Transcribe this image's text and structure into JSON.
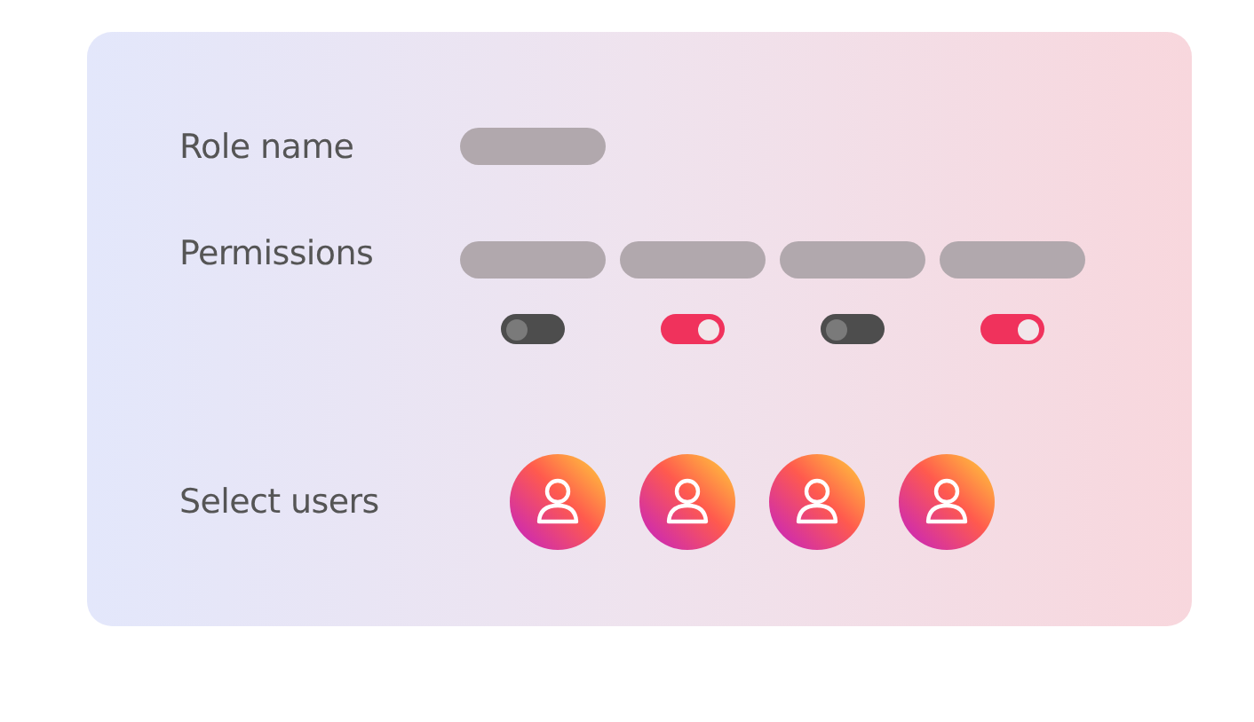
{
  "role_name": {
    "label": "Role name"
  },
  "permissions": {
    "label": "Permissions",
    "items": [
      {
        "on": false
      },
      {
        "on": true
      },
      {
        "on": false
      },
      {
        "on": true
      }
    ]
  },
  "select_users": {
    "label": "Select users",
    "users": [
      {
        "kind": "avatar"
      },
      {
        "kind": "avatar"
      },
      {
        "kind": "avatar"
      },
      {
        "kind": "avatar"
      }
    ]
  }
}
